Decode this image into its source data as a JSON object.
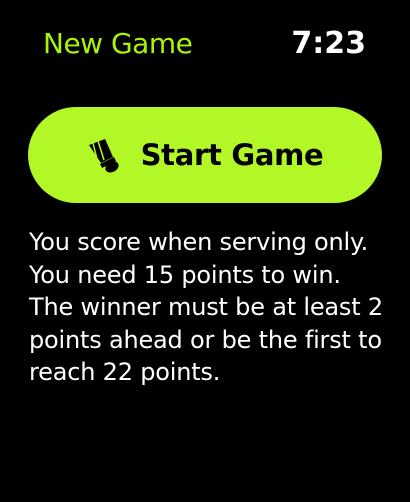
{
  "header": {
    "title": "New Game",
    "time": "7:23"
  },
  "start_button": {
    "label": "Start Game",
    "icon": "shuttlecock-icon"
  },
  "rules": {
    "text": "You score when serving only. You need 15 points to win. The winner must be at least 2 points ahead or be the first to reach 22 points."
  },
  "colors": {
    "accent": "#a6f50a",
    "button_bg": "#b2f726",
    "background": "#000000",
    "text": "#ffffff"
  }
}
